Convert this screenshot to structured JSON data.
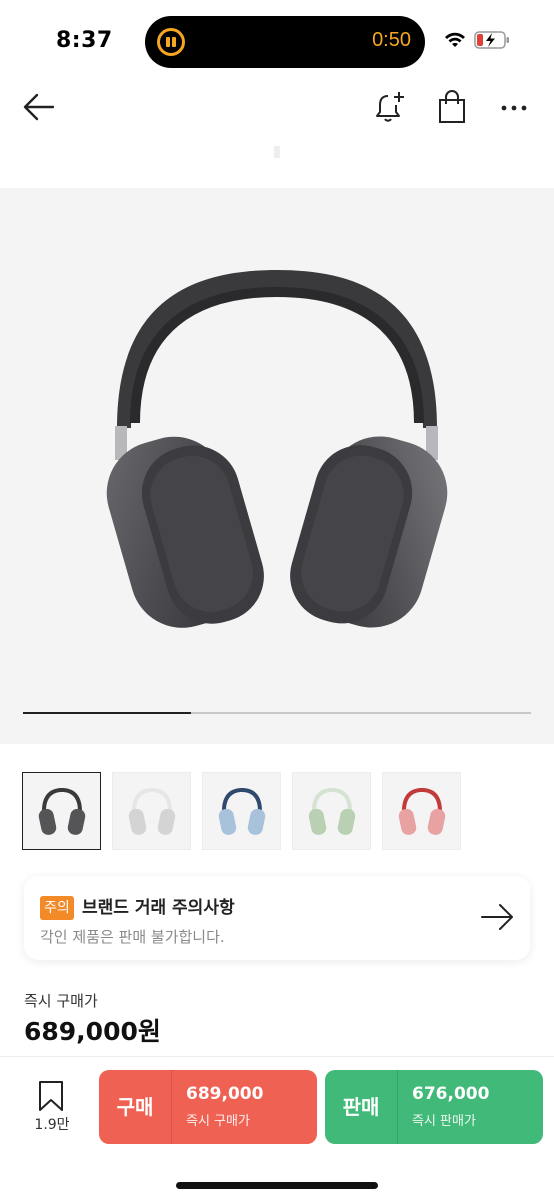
{
  "status_bar": {
    "time": "8:37",
    "timer": "0:50",
    "accent_color": "#f5a623"
  },
  "header": {
    "icons": [
      "back-arrow-icon",
      "bell-plus-icon",
      "shopping-bag-icon",
      "more-dots-icon"
    ]
  },
  "gallery": {
    "progress_fraction": 0.33,
    "background": "#f4f4f4"
  },
  "thumbnails": [
    {
      "color_name": "space-gray",
      "band": "#3a3a3a",
      "cup": "#555558",
      "selected": true
    },
    {
      "color_name": "silver",
      "band": "#e6e6e6",
      "cup": "#d4d4d4",
      "selected": false
    },
    {
      "color_name": "sky-blue",
      "band": "#2f4a6e",
      "cup": "#a8c2dc",
      "selected": false
    },
    {
      "color_name": "green",
      "band": "#d6e2d2",
      "cup": "#b9d0b2",
      "selected": false
    },
    {
      "color_name": "pink",
      "band": "#c23a3a",
      "cup": "#e8a2a2",
      "selected": false
    }
  ],
  "notice": {
    "badge": "주의",
    "title": "브랜드 거래 주의사항",
    "subtitle": "각인 제품은 판매 불가합니다."
  },
  "price": {
    "label": "즉시 구매가",
    "value": "689,000원"
  },
  "bottom_bar": {
    "wish_count": "1.9만",
    "buy": {
      "label": "구매",
      "price": "689,000",
      "sub": "즉시 구매가",
      "color": "#ef6253"
    },
    "sell": {
      "label": "판매",
      "price": "676,000",
      "sub": "즉시 판매가",
      "color": "#41b979"
    }
  }
}
